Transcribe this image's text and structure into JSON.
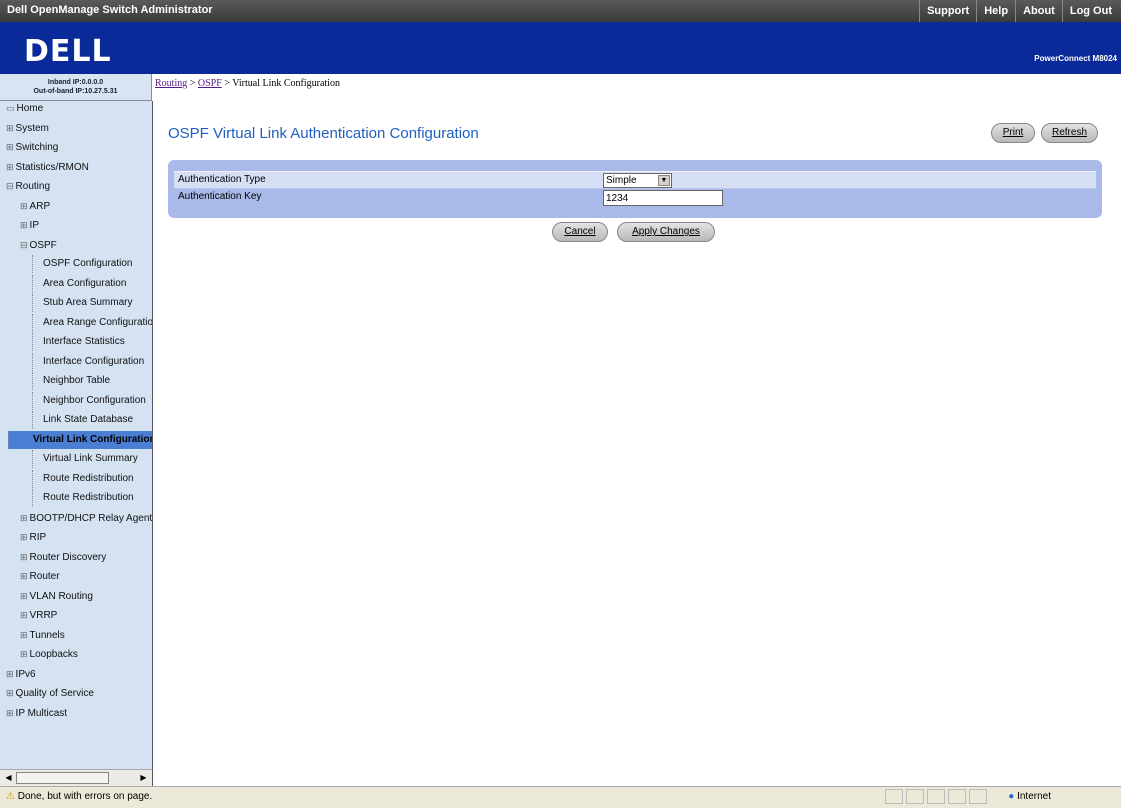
{
  "window": {
    "title": "Dell OpenManage Switch Administrator"
  },
  "top_links": [
    "Support",
    "Help",
    "About",
    "Log Out"
  ],
  "brand": {
    "logo": "DELL",
    "model": "PowerConnect M8024"
  },
  "ip_info": {
    "inband": "Inband IP:0.0.0.0",
    "oob": "Out-of-band IP:10.27.5.31"
  },
  "breadcrumb": {
    "routing": "Routing",
    "sep1": " > ",
    "ospf": "OSPF",
    "sep2": " > ",
    "current": "Virtual Link Configuration"
  },
  "sidebar": {
    "items": [
      {
        "label": "Home",
        "marker": "▭",
        "level": 0
      },
      {
        "label": "System",
        "marker": "⊞",
        "level": 0
      },
      {
        "label": "Switching",
        "marker": "⊞",
        "level": 0
      },
      {
        "label": "Statistics/RMON",
        "marker": "⊞",
        "level": 0
      },
      {
        "label": "Routing",
        "marker": "⊟",
        "level": 0
      },
      {
        "label": "ARP",
        "marker": "⊞",
        "level": 1
      },
      {
        "label": "IP",
        "marker": "⊞",
        "level": 1
      },
      {
        "label": "OSPF",
        "marker": "⊟",
        "level": 1
      },
      {
        "label": "OSPF Configuration",
        "marker": "",
        "level": 2
      },
      {
        "label": "Area Configuration",
        "marker": "",
        "level": 2
      },
      {
        "label": "Stub Area Summary",
        "marker": "",
        "level": 2
      },
      {
        "label": "Area Range Configuration",
        "marker": "",
        "level": 2
      },
      {
        "label": "Interface Statistics",
        "marker": "",
        "level": 2
      },
      {
        "label": "Interface Configuration",
        "marker": "",
        "level": 2
      },
      {
        "label": "Neighbor Table",
        "marker": "",
        "level": 2
      },
      {
        "label": "Neighbor Configuration",
        "marker": "",
        "level": 2
      },
      {
        "label": "Link State Database",
        "marker": "",
        "level": 2
      },
      {
        "label": "Virtual Link Configuration",
        "marker": "",
        "level": 2,
        "active": true
      },
      {
        "label": "Virtual Link Summary",
        "marker": "",
        "level": 2
      },
      {
        "label": "Route Redistribution",
        "marker": "",
        "level": 2
      },
      {
        "label": "Route Redistribution",
        "marker": "",
        "level": 2
      },
      {
        "label": "BOOTP/DHCP Relay Agent",
        "marker": "⊞",
        "level": 1
      },
      {
        "label": "RIP",
        "marker": "⊞",
        "level": 1
      },
      {
        "label": "Router Discovery",
        "marker": "⊞",
        "level": 1
      },
      {
        "label": "Router",
        "marker": "⊞",
        "level": 1
      },
      {
        "label": "VLAN Routing",
        "marker": "⊞",
        "level": 1
      },
      {
        "label": "VRRP",
        "marker": "⊞",
        "level": 1
      },
      {
        "label": "Tunnels",
        "marker": "⊞",
        "level": 1
      },
      {
        "label": "Loopbacks",
        "marker": "⊞",
        "level": 1
      },
      {
        "label": "IPv6",
        "marker": "⊞",
        "level": 0
      },
      {
        "label": "Quality of Service",
        "marker": "⊞",
        "level": 0
      },
      {
        "label": "IP Multicast",
        "marker": "⊞",
        "level": 0
      }
    ]
  },
  "main": {
    "title": "OSPF Virtual Link Authentication Configuration",
    "print_label": "Print",
    "refresh_label": "Refresh",
    "auth_type_label": "Authentication Type",
    "auth_type_value": "Simple",
    "auth_key_label": "Authentication Key",
    "auth_key_value": "1234",
    "cancel_label": "Cancel",
    "apply_label": "Apply Changes"
  },
  "status": {
    "message": "Done, but with errors on page.",
    "zone": "Internet"
  },
  "colors": {
    "brand_blue": "#0a2a9a",
    "title_blue": "#2060c0",
    "panel": "#a9b9ea",
    "active_nav": "#4a7fd4"
  }
}
